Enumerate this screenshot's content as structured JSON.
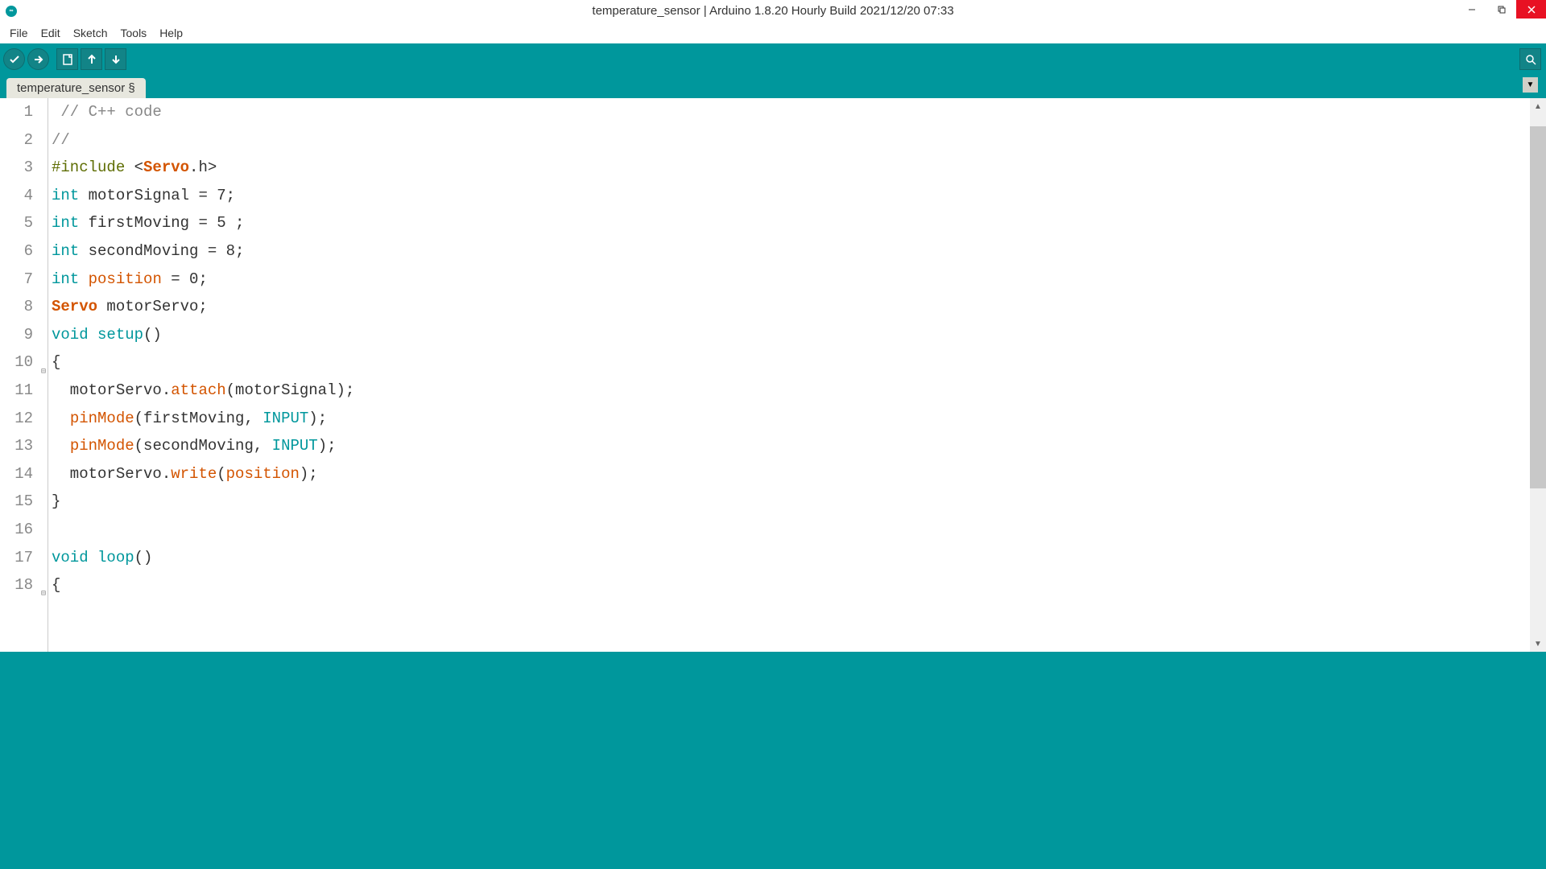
{
  "window": {
    "title": "temperature_sensor | Arduino 1.8.20 Hourly Build 2021/12/20 07:33"
  },
  "menu": {
    "items": [
      "File",
      "Edit",
      "Sketch",
      "Tools",
      "Help"
    ]
  },
  "tabs": {
    "active": "temperature_sensor §"
  },
  "code": {
    "lines": [
      {
        "num": "1",
        "tokens": [
          {
            "t": " // C++ code",
            "c": "c-comment"
          }
        ]
      },
      {
        "num": "2",
        "tokens": [
          {
            "t": "//",
            "c": "c-comment"
          }
        ]
      },
      {
        "num": "3",
        "tokens": [
          {
            "t": "#include ",
            "c": "c-preproc"
          },
          {
            "t": "<",
            "c": ""
          },
          {
            "t": "Servo",
            "c": "c-class"
          },
          {
            "t": ".h>",
            "c": ""
          }
        ]
      },
      {
        "num": "4",
        "tokens": [
          {
            "t": "int",
            "c": "c-type"
          },
          {
            "t": " motorSignal = 7;",
            "c": ""
          }
        ]
      },
      {
        "num": "5",
        "tokens": [
          {
            "t": "int",
            "c": "c-type"
          },
          {
            "t": " firstMoving = 5 ;",
            "c": ""
          }
        ]
      },
      {
        "num": "6",
        "tokens": [
          {
            "t": "int",
            "c": "c-type"
          },
          {
            "t": " secondMoving = 8;",
            "c": ""
          }
        ]
      },
      {
        "num": "7",
        "tokens": [
          {
            "t": "int",
            "c": "c-type"
          },
          {
            "t": " ",
            "c": ""
          },
          {
            "t": "position",
            "c": "c-var"
          },
          {
            "t": " = 0;",
            "c": ""
          }
        ]
      },
      {
        "num": "8",
        "tokens": [
          {
            "t": "Servo",
            "c": "c-class"
          },
          {
            "t": " motorServo;",
            "c": ""
          }
        ]
      },
      {
        "num": "9",
        "tokens": [
          {
            "t": "void",
            "c": "c-type"
          },
          {
            "t": " ",
            "c": ""
          },
          {
            "t": "setup",
            "c": "c-type"
          },
          {
            "t": "()",
            "c": ""
          }
        ]
      },
      {
        "num": "10",
        "fold": true,
        "tokens": [
          {
            "t": "{",
            "c": ""
          }
        ]
      },
      {
        "num": "11",
        "tokens": [
          {
            "t": "  motorServo.",
            "c": ""
          },
          {
            "t": "attach",
            "c": "c-func"
          },
          {
            "t": "(motorSignal);",
            "c": ""
          }
        ]
      },
      {
        "num": "12",
        "tokens": [
          {
            "t": "  ",
            "c": ""
          },
          {
            "t": "pinMode",
            "c": "c-func"
          },
          {
            "t": "(firstMoving, ",
            "c": ""
          },
          {
            "t": "INPUT",
            "c": "c-const"
          },
          {
            "t": ");",
            "c": ""
          }
        ]
      },
      {
        "num": "13",
        "tokens": [
          {
            "t": "  ",
            "c": ""
          },
          {
            "t": "pinMode",
            "c": "c-func"
          },
          {
            "t": "(secondMoving, ",
            "c": ""
          },
          {
            "t": "INPUT",
            "c": "c-const"
          },
          {
            "t": ");",
            "c": ""
          }
        ]
      },
      {
        "num": "14",
        "tokens": [
          {
            "t": "  motorServo.",
            "c": ""
          },
          {
            "t": "write",
            "c": "c-func"
          },
          {
            "t": "(",
            "c": ""
          },
          {
            "t": "position",
            "c": "c-var"
          },
          {
            "t": ");",
            "c": ""
          }
        ]
      },
      {
        "num": "15",
        "tokens": [
          {
            "t": "}",
            "c": ""
          }
        ]
      },
      {
        "num": "16",
        "tokens": [
          {
            "t": "",
            "c": ""
          }
        ]
      },
      {
        "num": "17",
        "tokens": [
          {
            "t": "void",
            "c": "c-type"
          },
          {
            "t": " ",
            "c": ""
          },
          {
            "t": "loop",
            "c": "c-type"
          },
          {
            "t": "()",
            "c": ""
          }
        ]
      },
      {
        "num": "18",
        "fold": true,
        "tokens": [
          {
            "t": "{",
            "c": ""
          }
        ]
      }
    ]
  }
}
